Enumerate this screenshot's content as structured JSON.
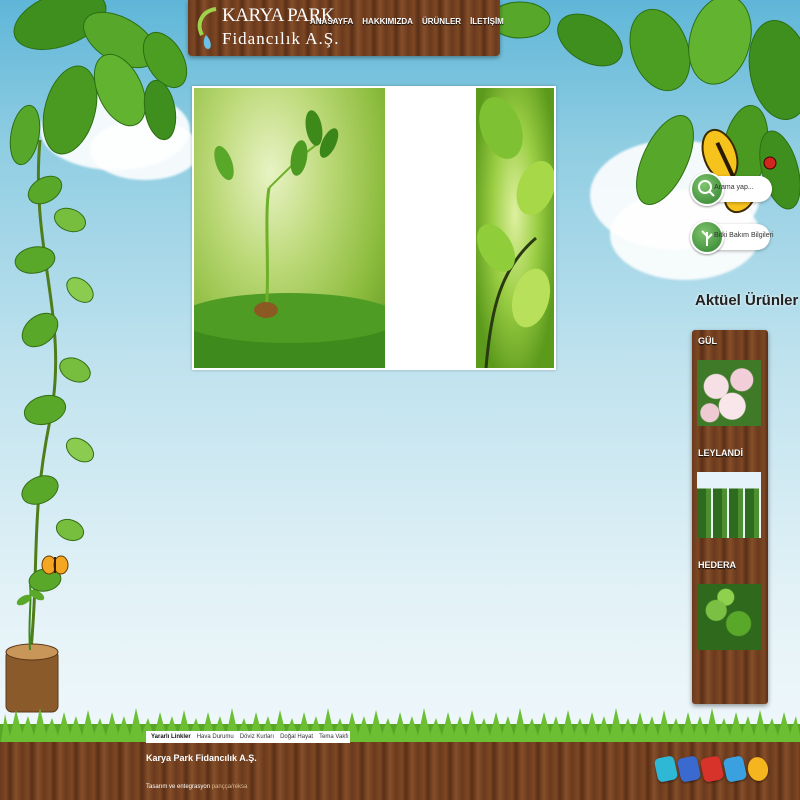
{
  "header": {
    "logo_title": "KARYA PARK",
    "logo_subtitle": "Fidancılık A.Ş.",
    "nav": [
      "ANASAYFA",
      "HAKKIMIZDA",
      "ÜRÜNLER",
      "İLETİŞİM"
    ]
  },
  "sidebar": {
    "search_label": "Arama yap...",
    "care_label": "Bitki Bakım Bilgileri",
    "products_title": "Aktüel Ürünler",
    "products": [
      {
        "name": "GÜL",
        "icon": "rose-image"
      },
      {
        "name": "LEYLANDİ",
        "icon": "cypress-image"
      },
      {
        "name": "HEDERA",
        "icon": "ivy-image"
      }
    ]
  },
  "footer": {
    "links_heading": "Yararlı Linkler",
    "links": [
      "Hava Durumu",
      "Döviz Kurları",
      "Doğal Hayat",
      "Tema Vakfı"
    ],
    "company": "Karya Park Fidancılık A.Ş.",
    "credit_prefix": "Tasarım ve entegrasyon",
    "credit_brand": "pançça/reksa",
    "social_icons": [
      "twitter-icon",
      "facebook-icon",
      "youtube-icon",
      "msn-icon",
      "smile-icon"
    ]
  },
  "colors": {
    "wood": "#6b3a1d",
    "leaf": "#4f9a24",
    "sky": "#8fcde2",
    "grass": "#5fae2a"
  }
}
